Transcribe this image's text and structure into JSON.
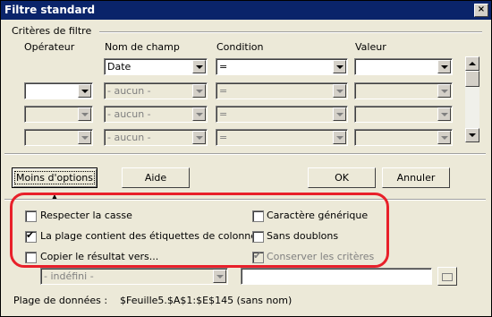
{
  "window": {
    "title": "Filtre standard",
    "close_label": "×"
  },
  "criteria": {
    "group_label": "Critères de filtre",
    "headers": {
      "operator": "Opérateur",
      "field_name": "Nom de champ",
      "condition": "Condition",
      "value": "Valeur"
    },
    "rows": [
      {
        "operator": "",
        "field": "Date",
        "condition": "=",
        "value": ""
      },
      {
        "operator": "",
        "field": "- aucun -",
        "condition": "=",
        "value": ""
      },
      {
        "operator": "",
        "field": "- aucun -",
        "condition": "=",
        "value": ""
      },
      {
        "operator": "",
        "field": "- aucun -",
        "condition": "=",
        "value": ""
      }
    ]
  },
  "buttons": {
    "less_options": "Moins d'options",
    "help": "Aide",
    "ok": "OK",
    "cancel": "Annuler"
  },
  "options": {
    "case_sensitive": {
      "label": "Respecter la casse",
      "checked": false
    },
    "header_row": {
      "label": "La plage contient des étiquettes de colonne",
      "checked": true
    },
    "copy_results": {
      "label": "Copier le résultat vers...",
      "checked": false
    },
    "regex": {
      "label": "Caractère générique",
      "checked": false
    },
    "no_duplicates": {
      "label": "Sans doublons",
      "checked": false
    },
    "keep_criteria": {
      "label": "Conserver les critères",
      "checked": true,
      "disabled": true
    },
    "copy_target_select": "- indéfini -",
    "copy_target_input": ""
  },
  "data_range": {
    "label": "Plage de données :",
    "value": "$Feuille5.$A$1:$E$145 (sans nom)"
  },
  "highlight_color": "#e8202a"
}
